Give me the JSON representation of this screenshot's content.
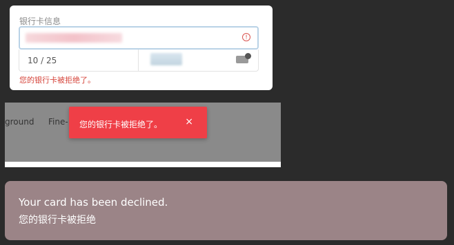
{
  "card": {
    "title": "银行卡信息",
    "expiry": "10 / 25",
    "error": "您的银行卡被拒绝了。"
  },
  "panel": {
    "tab1": "ground",
    "tab2": "Fine-"
  },
  "toast": {
    "message": "您的银行卡被拒绝了。",
    "close": "×"
  },
  "banner": {
    "line1": "Your card has been declined.",
    "line2": "您的银行卡被拒绝"
  },
  "colors": {
    "toast": "#ef3f47",
    "error_text": "#d6453b",
    "banner": "#9b8487",
    "focus_border": "#b9d2e6"
  }
}
